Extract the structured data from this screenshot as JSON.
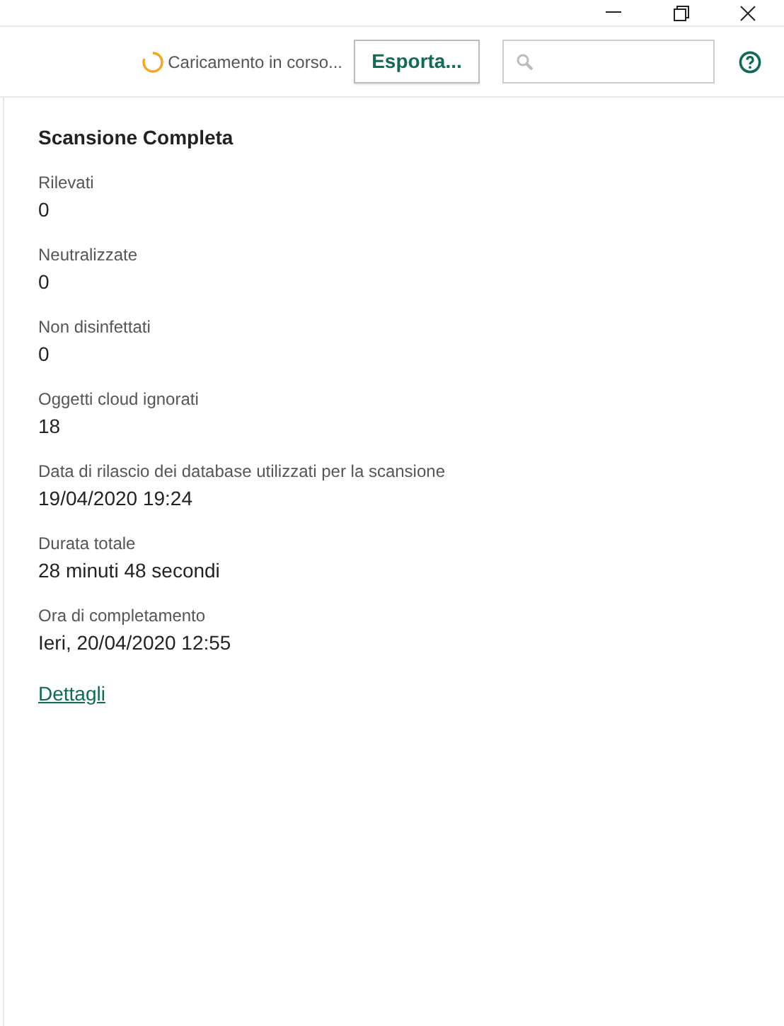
{
  "toolbar": {
    "loading_text": "Caricamento in corso...",
    "export_button": "Esporta..."
  },
  "title": "Scansione Completa",
  "fields": [
    {
      "label": "Rilevati",
      "value": "0"
    },
    {
      "label": "Neutralizzate",
      "value": "0"
    },
    {
      "label": "Non disinfettati",
      "value": "0"
    },
    {
      "label": "Oggetti cloud ignorati",
      "value": "18"
    },
    {
      "label": "Data di rilascio dei database utilizzati per la scansione",
      "value": "19/04/2020 19:24"
    },
    {
      "label": "Durata totale",
      "value": "28 minuti 48 secondi"
    },
    {
      "label": "Ora di completamento",
      "value": "Ieri, 20/04/2020 12:55"
    }
  ],
  "details_link": "Dettagli"
}
